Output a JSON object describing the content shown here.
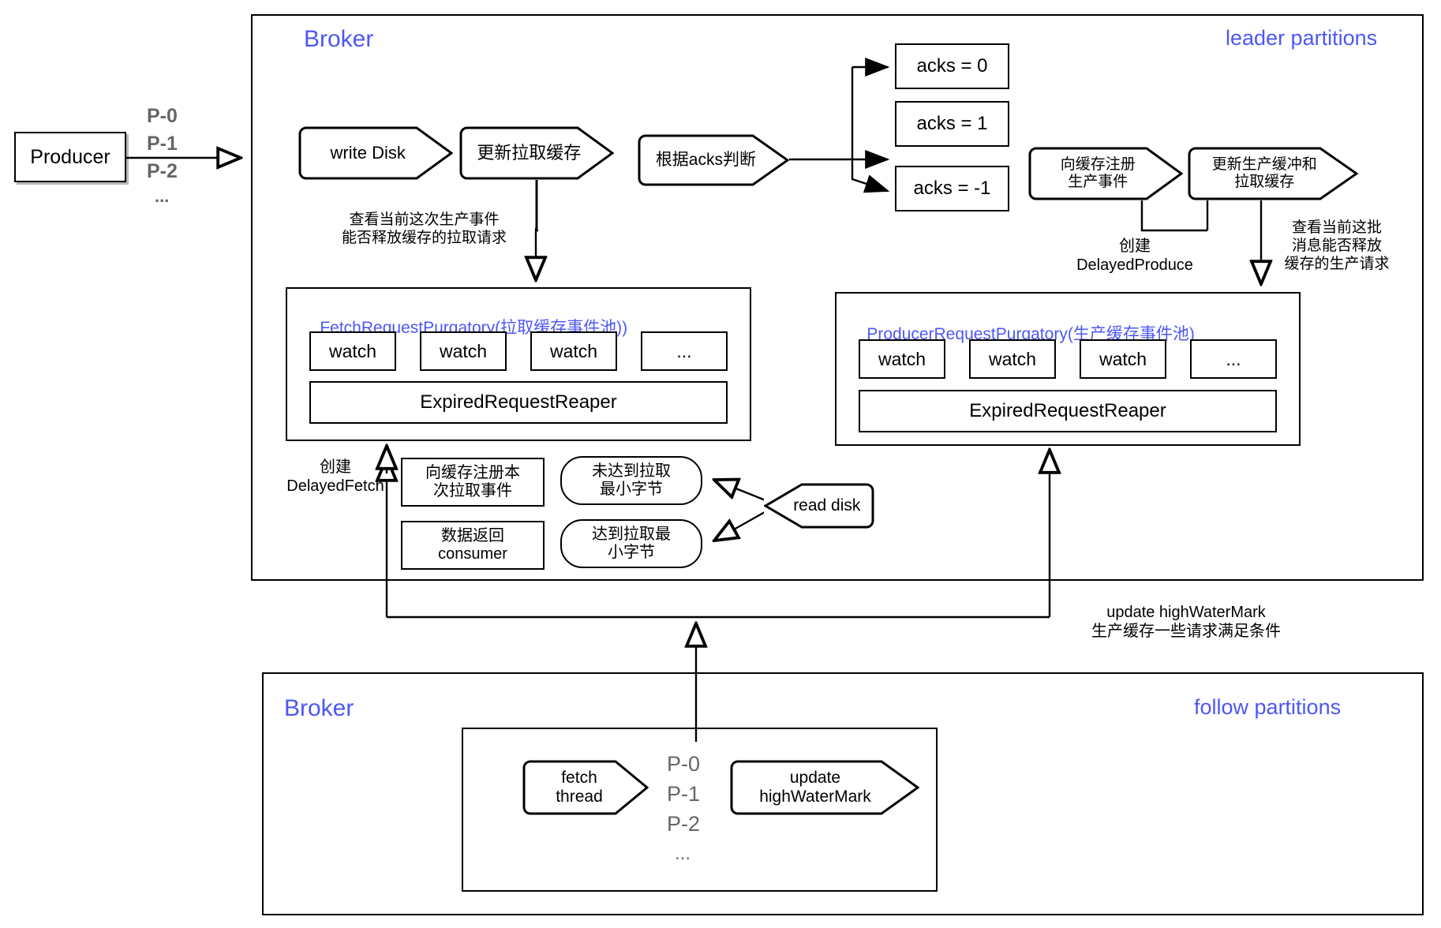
{
  "producer": {
    "label": "Producer"
  },
  "producer_partitions": {
    "p0": "P-0",
    "p1": "P-1",
    "p2": "P-2",
    "more": "..."
  },
  "leader_broker": {
    "title": "Broker",
    "corner_label": "leader partitions",
    "write_disk": "write Disk",
    "update_fetch_cache": "更新拉取缓存",
    "judge_by_acks": "根据acks判断",
    "acks": [
      "acks = 0",
      "acks = 1",
      "acks = -1"
    ],
    "register_produce_event": "向缓存注册\n生产事件",
    "update_produce_and_fetch_cache": "更新生产缓冲和\n拉取缓存",
    "note_release_fetch_requests": "查看当前这次生产事件\n能否释放缓存的拉取请求",
    "note_create_delayed_produce": "创建\nDelayedProduce",
    "note_release_produce_requests": "查看当前这批\n消息能否释放\n缓存的生产请求",
    "note_create_delayed_fetch": "创建\nDelayedFetch",
    "fetch_purgatory": {
      "title_en": "FetchRequestPurgatory",
      "title_cn": "(拉取缓存事件池))",
      "watches": [
        "watch",
        "watch",
        "watch"
      ],
      "ellipsis": "...",
      "reaper": "ExpiredRequestReaper"
    },
    "producer_purgatory": {
      "title_en": "ProducerRequestPurgatory",
      "title_cn": "(生产缓存事件池)",
      "watches": [
        "watch",
        "watch",
        "watch"
      ],
      "ellipsis": "...",
      "reaper": "ExpiredRequestReaper"
    },
    "register_fetch_event": "向缓存注册本\n次拉取事件",
    "data_return_consumer": "数据返回\nconsumer",
    "below_min_bytes": "未达到拉取\n最小字节",
    "reached_min_bytes": "达到拉取最\n小字节",
    "read_disk": "read disk"
  },
  "hwm_note": "update highWaterMark\n生产缓存一些请求满足条件",
  "follower_broker": {
    "title": "Broker",
    "corner_label": "follow partitions",
    "fetch_thread": "fetch\nthread",
    "update_hwm": "update\nhighWaterMark",
    "partitions": {
      "p0": "P-0",
      "p1": "P-1",
      "p2": "P-2",
      "more": "..."
    }
  },
  "colors": {
    "accent": "#4d57f5",
    "stroke": "#000000",
    "muted": "#666666"
  }
}
